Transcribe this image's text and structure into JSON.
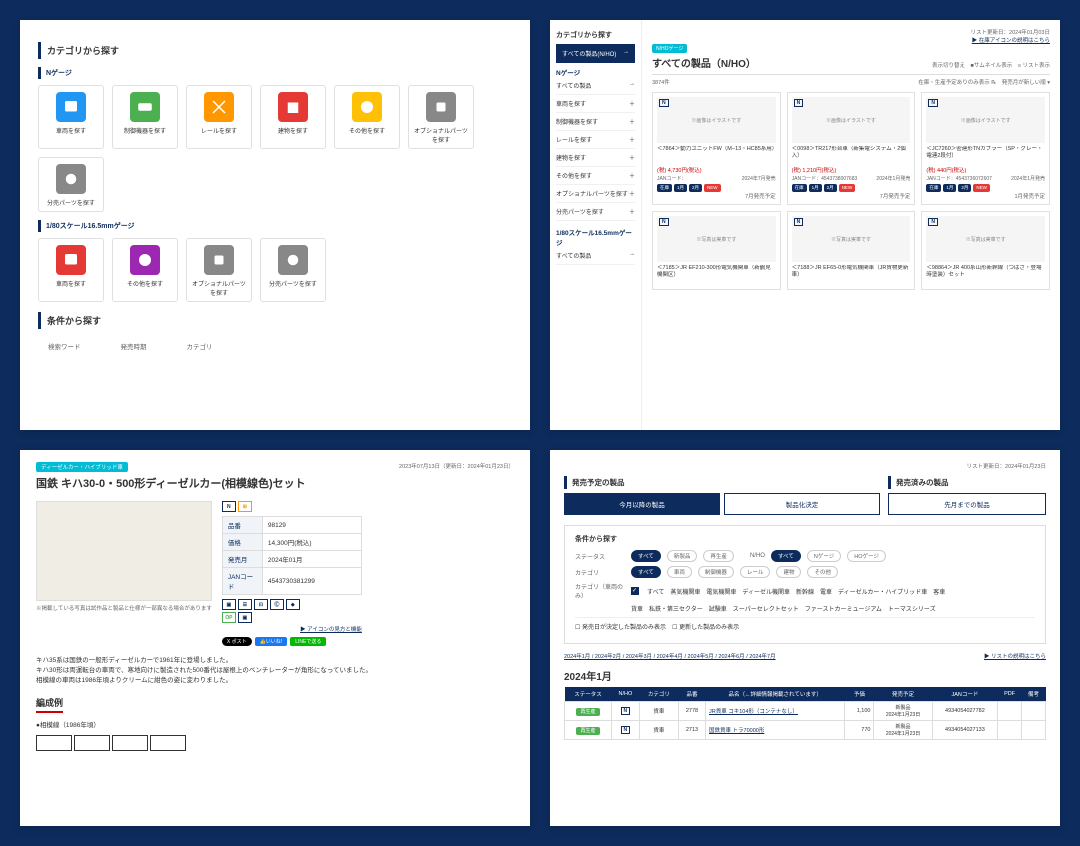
{
  "p1": {
    "sec1": "カテゴリから探す",
    "sub1": "Nゲージ",
    "sub2": "1/80スケール16.5mmゲージ",
    "sec2": "条件から探す",
    "ncat": [
      "車両を探す",
      "制御機器を探す",
      "レールを探す",
      "建物を探す",
      "その他を探す",
      "オプショナルパーツを探す",
      "分売パーツを探す"
    ],
    "hcat": [
      "車両を探す",
      "その他を探す",
      "オプショナルパーツを探す",
      "分売パーツを探す"
    ],
    "f1": "検索ワード",
    "f2": "発売時期",
    "f3": "カテゴリ"
  },
  "p2": {
    "side_h": "カテゴリから探す",
    "side_act": "すべての製品(N/HO)",
    "side_arrow": "→",
    "sub1": "Nゲージ",
    "sitems": [
      "すべての製品",
      "車両を探す",
      "制御機器を探す",
      "レールを探す",
      "建物を探す",
      "その他を探す",
      "オプショナルパーツを探す",
      "分売パーツを探す"
    ],
    "sub2": "1/80スケール16.5mmゲージ",
    "sitems2": [
      "すべての製品"
    ],
    "badge": "N/HOゲージ",
    "title": "すべての製品（N/HO）",
    "count": "3874件",
    "date": "リスト更新日：2024年01月03日",
    "iconlink": "▶ 在庫アイコンの説明はこちら",
    "view": "表示切り替え　■サムネイル表示　≡ リスト表示",
    "sort": "在庫・生産予定ありのみ表示 ℞　発売月が新しい順 ▾",
    "cards": [
      {
        "img": "※画像はイラストです",
        "name": "＜7864＞動力ユニットFW（M−13・HC85系用）",
        "price": "(税) 4,730円(税込)",
        "rel": "2024年7月発売",
        "jan": "JANコード：",
        "b": [
          "在庫",
          "1月",
          "2月"
        ],
        "sub": "7月発売予定"
      },
      {
        "img": "※画像はイラストです",
        "name": "＜0098＞TR217形台車（新集電システム・2個入）",
        "price": "(税) 1,210円(税込)",
        "rel": "2024年1月発売",
        "jan": "JANコード：4543738007683",
        "b": [
          "在庫",
          "1月",
          "2月"
        ],
        "sub": "7月発売予定"
      },
      {
        "img": "※画像はイラストです",
        "name": "＜JC7260＞密連形TNカプラー（SP・グレー・電連2段付）",
        "price": "(税) 440円(税込)",
        "rel": "2024年1月発売",
        "jan": "JANコード：4543736072607",
        "b": [
          "在庫",
          "1月",
          "2月"
        ],
        "sub": "1月発売予定"
      },
      {
        "img": "※写真は実車です",
        "name": "＜7185＞JR EF210-300形電気機関車（新鶴見機関区）",
        "price": "",
        "rel": "",
        "jan": "",
        "b": [],
        "sub": ""
      },
      {
        "img": "※写真は実車です",
        "name": "＜7188＞JR EF65-0形電気機関車（JR貨物更新車）",
        "price": "",
        "rel": "",
        "jan": "",
        "b": [],
        "sub": ""
      },
      {
        "img": "※写真は実車です",
        "name": "＜98864＞JR 400系山形新幹線（つばさ・登場時塗装）セット",
        "price": "",
        "rel": "",
        "jan": "",
        "b": [],
        "sub": ""
      }
    ],
    "new": "NEW"
  },
  "p3": {
    "pill": "ディーゼルカー・ハイブリッド車",
    "date": "2023年07月13日（更新日：2024年01月23日）",
    "title": "国鉄 キハ30-0・500形ディーゼルカー(相模線色)セット",
    "tbl": [
      [
        "品番",
        "98129"
      ],
      [
        "価格",
        "14,300円(税込)"
      ],
      [
        "発売月",
        "2024年01月"
      ],
      [
        "JANコード",
        "4543730381299"
      ]
    ],
    "imgnote": "※掲載している写真は試作品と製品と仕様が一部異なる場合があります",
    "iconlink": "▶ アイコンの見方と機能",
    "desc1": "キハ35系は国鉄の一般形ディーゼルカーで1961年に登場しました。",
    "desc2": "キハ30形は両運転台の車両で、寒地向けに製造された500番代は屋根上のベンチレーターが角形になっていました。",
    "desc3": "相模線の車両は1986年頃よりクリームに紺色の姿に変わりました。",
    "form": "編成例",
    "formsub": "●相模線（1986年頃）"
  },
  "p4": {
    "date": "リスト更新日：2024年01月23日",
    "t1h": "発売予定の製品",
    "t1a": "今月以降の製品",
    "t1b": "製品化決定",
    "t2h": "発売済みの製品",
    "t2a": "先月までの製品",
    "filt": "条件から探す",
    "r1l": "ステータス",
    "r1": [
      "すべて",
      "新製品",
      "再生産"
    ],
    "r1b": "N/HO",
    "r1c": [
      "すべて",
      "Nゲージ",
      "HOゲージ"
    ],
    "r2l": "カテゴリ",
    "r2": [
      "すべて",
      "車両",
      "制御機器",
      "レール",
      "建物",
      "その他"
    ],
    "r3l": "カテゴリ（車両のみ）",
    "r3": [
      "すべて",
      "蒸気機関車",
      "電気機関車",
      "ディーゼル機関車",
      "新幹線",
      "電車",
      "ディーゼルカー・ハイブリッド車",
      "客車"
    ],
    "r3b": [
      "貨車",
      "私鉄・第三セクター",
      "試験車",
      "スーパーセレクトセット",
      "ファーストカーミュージアム",
      "トーマスシリーズ"
    ],
    "c1": "発売日が決定した製品のみ表示",
    "c2": "更新した製品のみ表示",
    "nav": "2024年1月 / 2024年2月 / 2024年3月 / 2024年4月 / 2024年5月 / 2024年6月 / 2024年7月",
    "navr": "▶ リストの説明はこちら",
    "month": "2024年1月",
    "th": [
      "ステータス",
      "N/HO",
      "カテゴリ",
      "品番",
      "品名（←詳細情報掲載されています）",
      "予価",
      "発売予定",
      "JANコード",
      "PDF",
      "備考"
    ],
    "rows": [
      {
        "st": "再生産",
        "cat": "貨車",
        "no": "2778",
        "name": "JR貨車 コキ104形（コンテナなし）",
        "price": "1,100",
        "rel": "新製品\n2024年1月23日",
        "jan": "4934054027782"
      },
      {
        "st": "再生産",
        "cat": "貨車",
        "no": "2713",
        "name": "国鉄貨車 トラ70000形",
        "price": "770",
        "rel": "新製品\n2024年1月23日",
        "jan": "4934054027133"
      }
    ]
  }
}
